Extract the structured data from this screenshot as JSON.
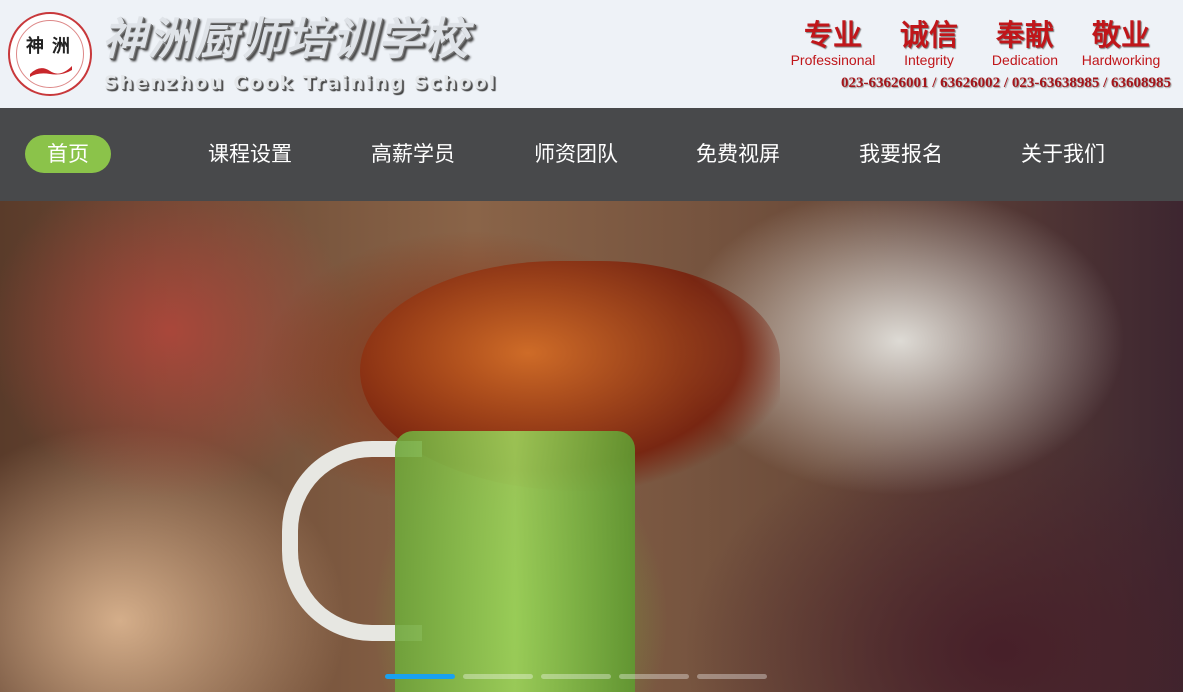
{
  "header": {
    "emblem_chars": [
      "神",
      "洲"
    ],
    "title": "神洲厨师培训学校",
    "subtitle": "Shenzhou Cook Training School",
    "values": [
      {
        "cn": "专业",
        "en": "Professinonal"
      },
      {
        "cn": "诚信",
        "en": "Integrity"
      },
      {
        "cn": "奉献",
        "en": "Dedication"
      },
      {
        "cn": "敬业",
        "en": "Hardworking"
      }
    ],
    "phones": "023-63626001 / 63626002 / 023-63638985 / 63608985"
  },
  "nav": {
    "items": [
      "首页",
      "课程设置",
      "高薪学员",
      "师资团队",
      "免费视屏",
      "我要报名",
      "关于我们"
    ],
    "active_index": 0
  },
  "hero": {
    "slide_count": 5,
    "active_slide": 0
  },
  "colors": {
    "nav_bg": "#48494b",
    "nav_active": "#8bc34a",
    "brand_red": "#c0161a",
    "indicator_active": "#19a1f0"
  }
}
